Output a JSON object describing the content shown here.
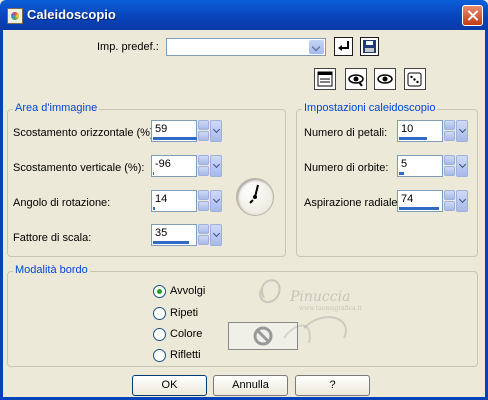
{
  "window": {
    "title": "Caleidoscopio"
  },
  "preset": {
    "label": "Imp. predef.:",
    "value": ""
  },
  "area": {
    "title": "Area d'immagine",
    "fields": [
      {
        "label": "Scostamento orizzontale (%):",
        "value": "59",
        "level": 0.8
      },
      {
        "label": "Scostamento verticale (%):",
        "value": "-96",
        "level": 0.02
      },
      {
        "label": "Angolo di rotazione:",
        "value": "14",
        "level": 0.04
      },
      {
        "label": "Fattore di scala:",
        "value": "35",
        "level": 0.65
      }
    ]
  },
  "kaleido": {
    "title": "Impostazioni caleidoscopio",
    "fields": [
      {
        "label": "Numero di petali:",
        "value": "10",
        "level": 0.5
      },
      {
        "label": "Numero di orbite:",
        "value": "5",
        "level": 0.1
      },
      {
        "label": "Aspirazione radiale:",
        "value": "74",
        "level": 0.74
      }
    ]
  },
  "edge": {
    "title": "Modalità bordo",
    "options": [
      "Avvolgi",
      "Ripeti",
      "Colore",
      "Rifletti"
    ],
    "selected": "Avvolgi"
  },
  "buttons": {
    "ok": "OK",
    "cancel": "Annulla",
    "help": "?"
  },
  "watermark": {
    "name": "Pinuccia",
    "site": "www.taomagrafica.it"
  }
}
